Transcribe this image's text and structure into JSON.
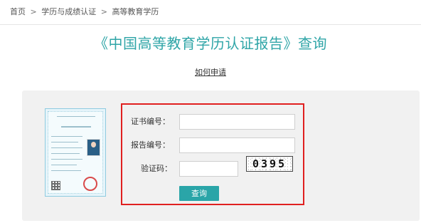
{
  "breadcrumb": {
    "items": [
      "首页",
      "学历与成绩认证",
      "高等教育学历"
    ],
    "separator": ">"
  },
  "page": {
    "title": "《中国高等教育学历认证报告》查询",
    "apply_link": "如何申请"
  },
  "form": {
    "cert_number_label": "证书编号：",
    "report_number_label": "报告编号：",
    "captcha_label": "验证码：",
    "cert_number_value": "",
    "report_number_value": "",
    "captcha_value": "",
    "captcha_image_text": "0395",
    "submit_label": "查询"
  },
  "colors": {
    "accent": "#2aa5a8",
    "highlight_border": "#e02020",
    "card_background": "#f1f1f1"
  }
}
